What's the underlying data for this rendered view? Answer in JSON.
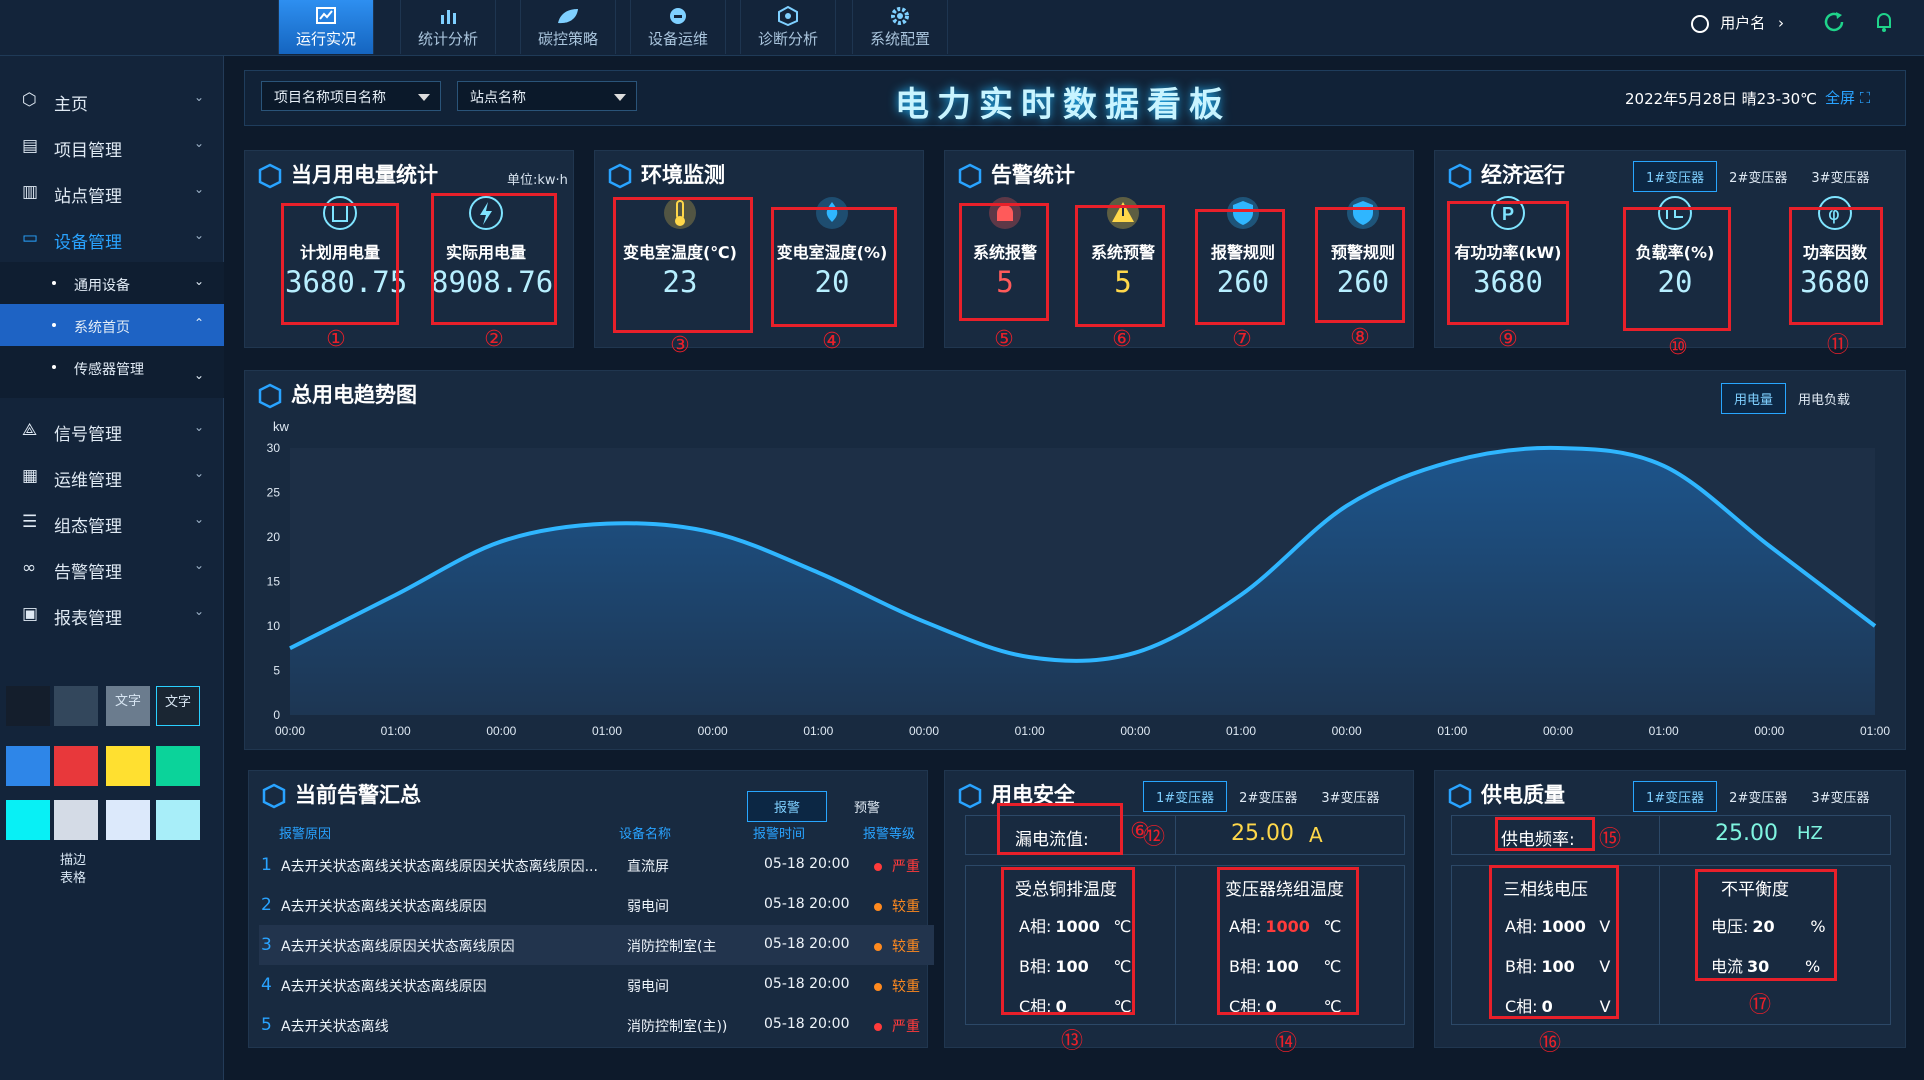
{
  "nav": {
    "tabs": [
      {
        "label": "运行实况",
        "icon": "chart-icon"
      },
      {
        "label": "统计分析",
        "icon": "bar-icon"
      },
      {
        "label": "碳控策略",
        "icon": "leaf-icon"
      },
      {
        "label": "设备运维",
        "icon": "wrench-icon"
      },
      {
        "label": "诊断分析",
        "icon": "diagnose-icon"
      },
      {
        "label": "系统配置",
        "icon": "gear-icon"
      }
    ],
    "username": "用户名"
  },
  "sidebar": {
    "items": [
      {
        "label": "主页"
      },
      {
        "label": "项目管理"
      },
      {
        "label": "站点管理"
      },
      {
        "label": "设备管理"
      },
      {
        "label": "信号管理"
      },
      {
        "label": "运维管理"
      },
      {
        "label": "组态管理"
      },
      {
        "label": "告警管理"
      },
      {
        "label": "报表管理"
      }
    ],
    "subs": [
      {
        "label": "通用设备"
      },
      {
        "label": "系统首页"
      },
      {
        "label": "传感器管理"
      }
    ],
    "swatch_text": [
      "文字",
      "文字"
    ],
    "swatch_caption": [
      "描边",
      "表格"
    ],
    "colors": {
      "accent": "#1e63c4",
      "red": "#e8202a",
      "yellow": "#ffd84a",
      "teal": "#0bd39a",
      "cyan": "#08f0f5"
    }
  },
  "header": {
    "project": "项目名称项目名称",
    "site": "站点名称",
    "title": "电力实时数据看板",
    "datetime": "2022年5月28日 晴23-30℃",
    "fullscreen": "全屏"
  },
  "monthly": {
    "title": "当月用电量统计",
    "unit": "单位:kw·h",
    "items": [
      {
        "label": "计划用电量",
        "value": "3680.75",
        "num": "①"
      },
      {
        "label": "实际用电量",
        "value": "8908.76",
        "num": "②"
      }
    ]
  },
  "env": {
    "title": "环境监测",
    "items": [
      {
        "label": "变电室温度(℃)",
        "value": "23",
        "num": "③"
      },
      {
        "label": "变电室湿度(%)",
        "value": "20",
        "num": "④"
      }
    ]
  },
  "alarm": {
    "title": "告警统计",
    "items": [
      {
        "label": "系统报警",
        "value": "5",
        "num": "⑤"
      },
      {
        "label": "系统预警",
        "value": "5",
        "num": "⑥"
      },
      {
        "label": "报警规则",
        "value": "260",
        "num": "⑦"
      },
      {
        "label": "预警规则",
        "value": "260",
        "num": "⑧"
      }
    ]
  },
  "econ": {
    "title": "经济运行",
    "tabs": [
      "1#变压器",
      "2#变压器",
      "3#变压器"
    ],
    "items": [
      {
        "label": "有功功率(kW)",
        "value": "3680",
        "num": "⑨"
      },
      {
        "label": "负载率(%)",
        "value": "20",
        "num": "⑩"
      },
      {
        "label": "功率因数",
        "value": "3680",
        "num": "⑪"
      }
    ]
  },
  "trend": {
    "title": "总用电趋势图",
    "tabs": [
      "用电量",
      "用电负载"
    ]
  },
  "chart_data": {
    "type": "area",
    "ylabel": "kw",
    "ylim": [
      0,
      30
    ],
    "yticks": [
      0,
      5,
      10,
      15,
      20,
      25,
      30
    ],
    "categories": [
      "00:00",
      "01:00",
      "00:00",
      "01:00",
      "00:00",
      "01:00",
      "00:00",
      "01:00",
      "00:00",
      "01:00",
      "00:00",
      "01:00",
      "00:00",
      "01:00",
      "00:00",
      "01:00"
    ],
    "series": [
      {
        "values": [
          7.5,
          13.5,
          19.5,
          21.5,
          20.5,
          16.0,
          10.5,
          6.5,
          7.0,
          13.5,
          23.5,
          28.5,
          30.0,
          28.0,
          19.0,
          10.0
        ]
      }
    ],
    "colors": {
      "line": "#2fb6ff",
      "fill": "#1d5c99"
    }
  },
  "alarms_list": {
    "title": "当前告警汇总",
    "tabs": [
      "报警",
      "预警"
    ],
    "headers": [
      "报警原因",
      "设备名称",
      "报警时间",
      "报警等级"
    ],
    "rows": [
      {
        "n": "1",
        "reason": "A去开关状态离线关状态离线原因关状态离线原因...",
        "device": "直流屏",
        "time": "05-18 20:00",
        "level": "严重",
        "color": "#ff3b3b"
      },
      {
        "n": "2",
        "reason": "A去开关状态离线关状态离线原因",
        "device": "弱电间",
        "time": "05-18 20:00",
        "level": "较重",
        "color": "#ff8a1f"
      },
      {
        "n": "3",
        "reason": "A去开关状态离线原因关状态离线原因",
        "device": "消防控制室(主",
        "time": "05-18 20:00",
        "level": "较重",
        "color": "#ff8a1f"
      },
      {
        "n": "4",
        "reason": "A去开关状态离线关状态离线原因",
        "device": "弱电间",
        "time": "05-18 20:00",
        "level": "较重",
        "color": "#ff8a1f"
      },
      {
        "n": "5",
        "reason": "A去开关状态离线",
        "device": "消防控制室(主))",
        "time": "05-18 20:00",
        "level": "严重",
        "color": "#ff3b3b"
      }
    ]
  },
  "safety": {
    "title": "用电安全",
    "tabs": [
      "1#变压器",
      "2#变压器",
      "3#变压器"
    ],
    "leak_label": "漏电流值:",
    "leak_value": "25.00",
    "leak_unit": "A",
    "leak_num": "⑫",
    "leak_num_b": "⑥",
    "copper_title": "受总铜排温度",
    "winding_title": "变压器绕组温度",
    "copper": [
      {
        "ph": "A相:",
        "v": "1000",
        "u": "℃"
      },
      {
        "ph": "B相:",
        "v": "100",
        "u": "℃"
      },
      {
        "ph": "C相:",
        "v": "0",
        "u": "℃"
      }
    ],
    "winding": [
      {
        "ph": "A相:",
        "v": "1000",
        "u": "℃"
      },
      {
        "ph": "B相:",
        "v": "100",
        "u": "℃"
      },
      {
        "ph": "C相:",
        "v": "0",
        "u": "℃"
      }
    ],
    "num13": "⑬",
    "num14": "⑭"
  },
  "quality": {
    "title": "供电质量",
    "tabs": [
      "1#变压器",
      "2#变压器",
      "3#变压器"
    ],
    "freq_label": "供电频率:",
    "freq_value": "25.00",
    "freq_unit": "HZ",
    "num15": "⑮",
    "voltage_title": "三相线电压",
    "voltage": [
      {
        "ph": "A相:",
        "v": "1000",
        "u": "V"
      },
      {
        "ph": "B相:",
        "v": "100",
        "u": "V"
      },
      {
        "ph": "C相:",
        "v": "0",
        "u": "V"
      }
    ],
    "unbal_title": "不平衡度",
    "unbal": [
      {
        "ph": "电压:",
        "v": "20",
        "u": "%"
      },
      {
        "ph": "电流",
        "v": "30",
        "u": "%"
      }
    ],
    "num16": "⑯",
    "num17": "⑰"
  }
}
